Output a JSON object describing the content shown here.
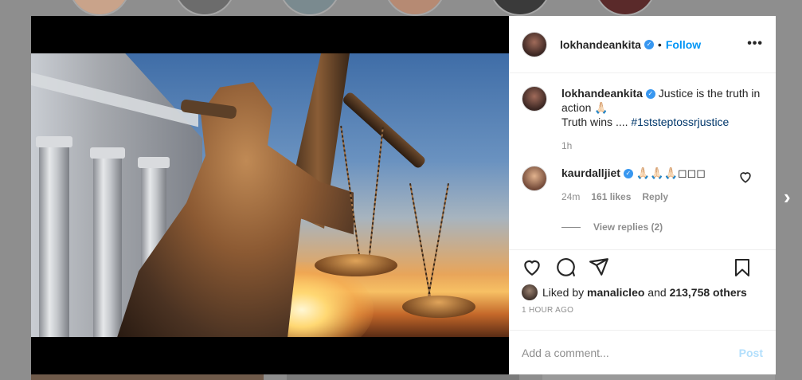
{
  "post": {
    "username": "lokhandeankita",
    "follow_label": "Follow",
    "caption_line1": "Justice is the truth in action 🙏🏻",
    "caption_line2": "Truth wins .... ",
    "caption_hashtag": "#1ststeptossrjustice",
    "caption_time": "1h",
    "more_label": "•••"
  },
  "comments": [
    {
      "username": "kaurdalljiet",
      "text": "🙏🏻🙏🏻🙏🏻◻◻◻",
      "age": "24m",
      "likes": "161 likes",
      "reply_label": "Reply",
      "view_replies": "View replies (2)"
    }
  ],
  "liked_by": {
    "prefix": "Liked by ",
    "user": "manalicleo",
    "middle": " and ",
    "others": "213,758 others"
  },
  "post_age": "1 HOUR AGO",
  "comment_box": {
    "placeholder": "Add a comment...",
    "post_label": "Post"
  },
  "colors": {
    "accent": "#0095f6",
    "verified": "#3897f0",
    "post_disabled": "#b2dffc",
    "overlay": "#8e8e8e"
  },
  "icons": [
    "verified-badge-icon",
    "more-options-icon",
    "heart-icon",
    "comment-icon",
    "share-icon",
    "save-icon",
    "chevron-right-icon"
  ]
}
